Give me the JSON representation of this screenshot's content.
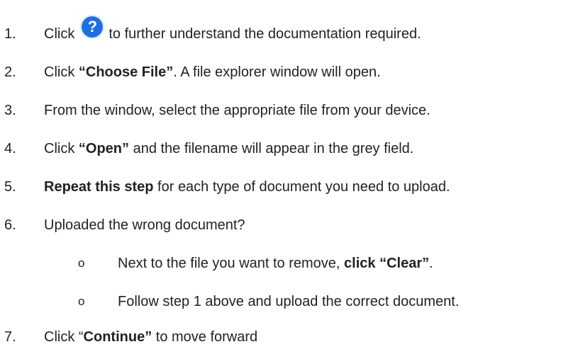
{
  "steps": [
    {
      "num": "1.",
      "pre": "Click",
      "icon": "question-mark-help-icon",
      "icon_glyph": "?",
      "post": "to further understand the documentation required."
    },
    {
      "num": "2.",
      "pre": "Click ",
      "bold": "“Choose File”",
      "post": ". A file explorer window will open."
    },
    {
      "num": "3.",
      "text": "From the window, select the appropriate file from your device."
    },
    {
      "num": "4.",
      "pre": "Click ",
      "bold": "“Open”",
      "post": " and the filename will appear in the grey field."
    },
    {
      "num": "5.",
      "bold": "Repeat this step",
      "post": " for each type of document you need to upload."
    },
    {
      "num": "6.",
      "text": "Uploaded the wrong document?"
    },
    {
      "bullet": "o",
      "pre": "Next to the file you want to remove, ",
      "bold": "click “Clear”",
      "post": "."
    },
    {
      "bullet": "o",
      "text": "Follow step 1 above and upload the correct document."
    },
    {
      "num": "7.",
      "pre": "Click “",
      "bold": "Continue”",
      "post": " to move forward"
    }
  ],
  "colors": {
    "text": "#222222",
    "help_icon": "#1f6fe0"
  }
}
